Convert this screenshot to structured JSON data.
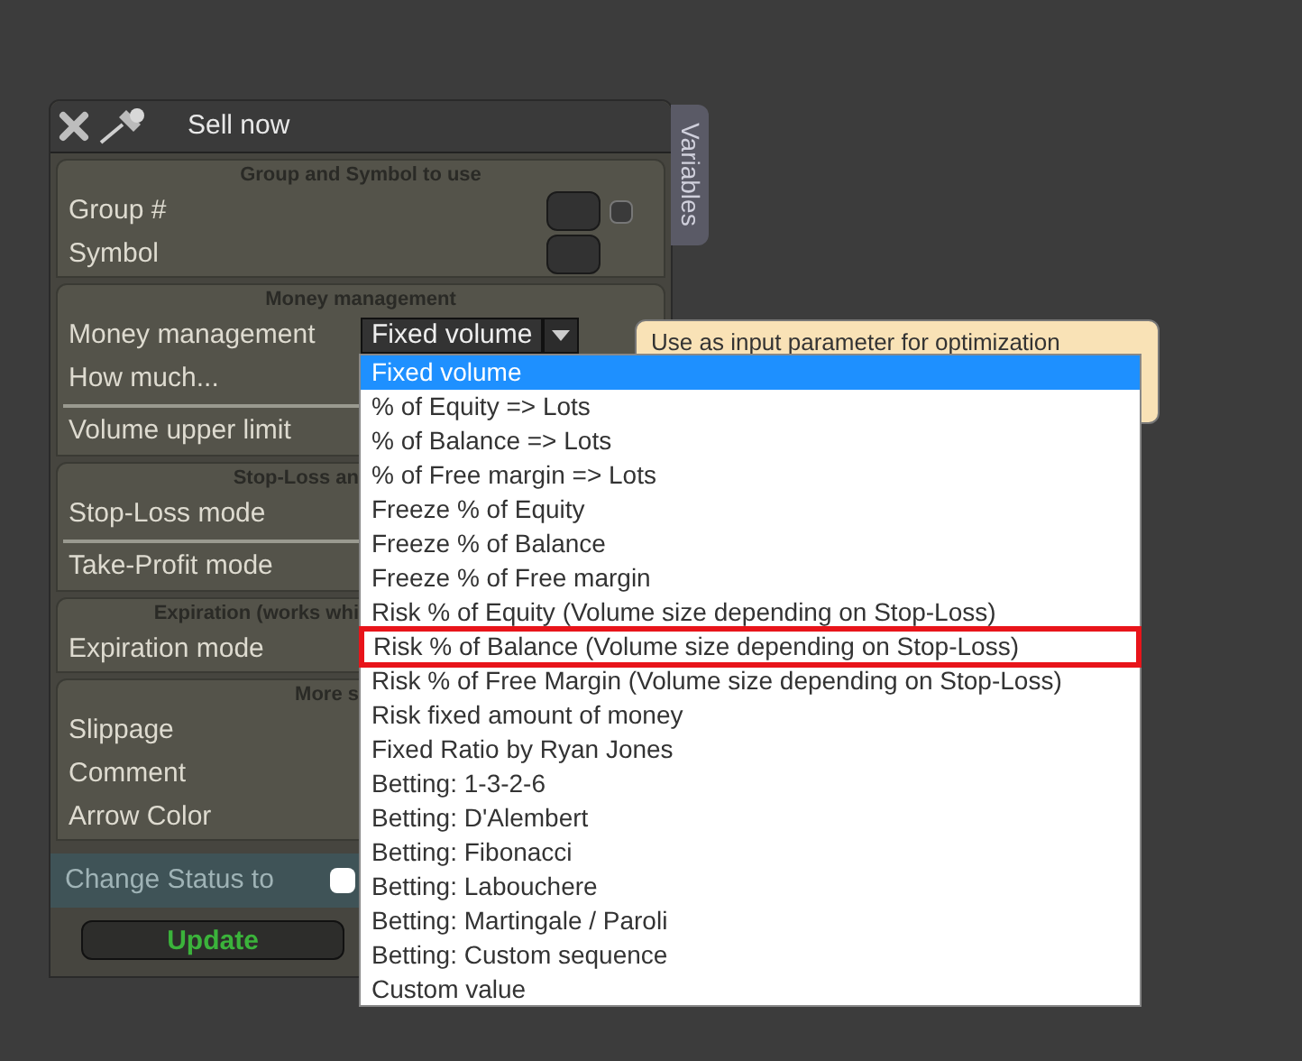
{
  "window": {
    "title": "Sell now",
    "side_tab": "Variables"
  },
  "sections": [
    {
      "header": "Group and Symbol to use",
      "cut_by_list": false,
      "rows": [
        {
          "label": "Group #",
          "kind": "box_check",
          "checked": false,
          "divider_before": false
        },
        {
          "label": "Symbol",
          "kind": "box",
          "divider_before": false
        }
      ]
    },
    {
      "header": "Money management",
      "cut_by_list": false,
      "rows": [
        {
          "label": "Money management",
          "kind": "select",
          "value": "Fixed volume",
          "divider_before": false
        },
        {
          "label": "How much...",
          "kind": "plain",
          "divider_before": false
        },
        {
          "label": "Volume upper limit",
          "kind": "plain",
          "divider_before": true
        }
      ]
    },
    {
      "header": "Stop-Loss an",
      "cut_by_list": true,
      "rows": [
        {
          "label": "Stop-Loss mode",
          "kind": "plain",
          "divider_before": false
        },
        {
          "label": "Take-Profit mode",
          "kind": "plain",
          "divider_before": true
        }
      ]
    },
    {
      "header": "Expiration (works whi",
      "cut_by_list": true,
      "rows": [
        {
          "label": "Expiration mode",
          "kind": "plain",
          "divider_before": false
        }
      ]
    },
    {
      "header": "More s",
      "cut_by_list": true,
      "rows": [
        {
          "label": "Slippage",
          "kind": "plain",
          "divider_before": false
        },
        {
          "label": "Comment",
          "kind": "plain",
          "divider_before": false
        },
        {
          "label": "Arrow Color",
          "kind": "plain",
          "divider_before": false
        }
      ]
    }
  ],
  "status_row": {
    "label": "Change Status to",
    "checked": false
  },
  "update_button": "Update",
  "tooltip": "Use as input parameter for optimization",
  "dropdown": [
    {
      "label": "Fixed volume",
      "selected": true,
      "outlined": false
    },
    {
      "label": "% of Equity => Lots",
      "selected": false,
      "outlined": false
    },
    {
      "label": "% of Balance => Lots",
      "selected": false,
      "outlined": false
    },
    {
      "label": "% of Free margin => Lots",
      "selected": false,
      "outlined": false
    },
    {
      "label": "Freeze % of Equity",
      "selected": false,
      "outlined": false
    },
    {
      "label": "Freeze % of Balance",
      "selected": false,
      "outlined": false
    },
    {
      "label": "Freeze % of Free margin",
      "selected": false,
      "outlined": false
    },
    {
      "label": "Risk % of Equity (Volume size depending on Stop-Loss)",
      "selected": false,
      "outlined": false
    },
    {
      "label": "Risk % of Balance (Volume size depending on Stop-Loss)",
      "selected": false,
      "outlined": true
    },
    {
      "label": "Risk % of Free Margin (Volume size depending on Stop-Loss)",
      "selected": false,
      "outlined": false
    },
    {
      "label": "Risk fixed amount of money",
      "selected": false,
      "outlined": false
    },
    {
      "label": "Fixed Ratio by Ryan Jones",
      "selected": false,
      "outlined": false
    },
    {
      "label": "Betting: 1-3-2-6",
      "selected": false,
      "outlined": false
    },
    {
      "label": "Betting: D'Alembert",
      "selected": false,
      "outlined": false
    },
    {
      "label": "Betting: Fibonacci",
      "selected": false,
      "outlined": false
    },
    {
      "label": "Betting: Labouchere",
      "selected": false,
      "outlined": false
    },
    {
      "label": "Betting: Martingale / Paroli",
      "selected": false,
      "outlined": false
    },
    {
      "label": "Betting: Custom sequence",
      "selected": false,
      "outlined": false
    },
    {
      "label": "Custom value",
      "selected": false,
      "outlined": false
    }
  ]
}
